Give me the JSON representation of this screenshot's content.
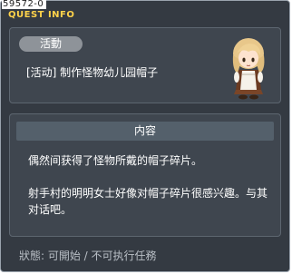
{
  "window": {
    "quest_id": "59572-0",
    "title": "QUEST INFO"
  },
  "quest": {
    "tag": "活動",
    "name": "[活动] 制作怪物幼儿园帽子"
  },
  "content": {
    "header": "内容",
    "paragraphs": [
      "偶然间获得了怪物所戴的帽子碎片。",
      "射手村的明明女士好像对帽子碎片很感兴趣。与其对话吧。"
    ]
  },
  "status": {
    "text": "狀態: 可開始 / 不可执行任務"
  },
  "colors": {
    "title_yellow": "#ffd34a",
    "window_bg": "#343a42",
    "panel_bg": "#3f464f",
    "header_bg": "#54606b",
    "tag_bg": "#8e9399"
  },
  "icons": {
    "npc": "npc-portrait-icon"
  }
}
